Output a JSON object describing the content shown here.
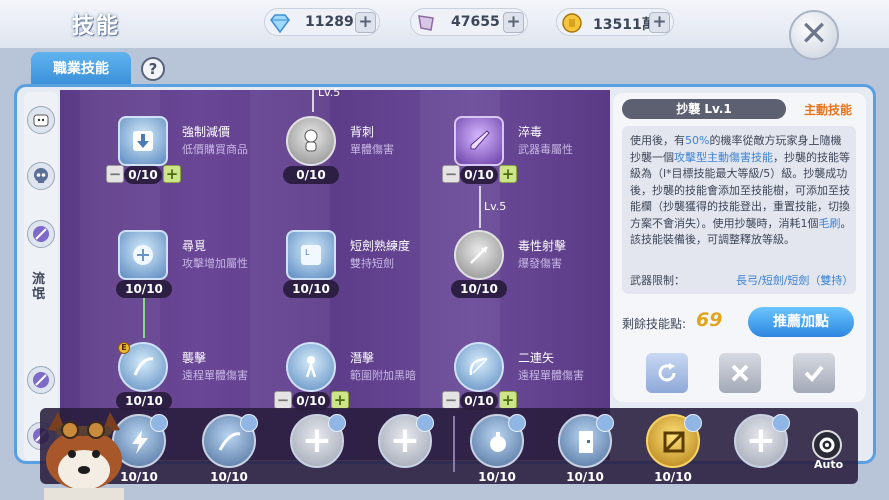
{
  "header": {
    "title": "技能",
    "currencies": [
      {
        "name": "diamond",
        "icon": "diamond-icon",
        "value": "11289"
      },
      {
        "name": "crystal",
        "icon": "crystal-icon",
        "value": "47655"
      },
      {
        "name": "zeny",
        "icon": "coin-icon",
        "value": "13511萬"
      }
    ],
    "close_icon": "close-icon"
  },
  "tabs": {
    "job_skill": "職業技能",
    "help": "?"
  },
  "sidebar": {
    "label": "流氓",
    "icons": [
      "poring-icon",
      "skull-icon",
      "dagger-icon",
      "bow-icon",
      "dagger-icon-2"
    ]
  },
  "skill_tree": {
    "skills": [
      {
        "id": "force_sale",
        "name": "強制減價",
        "desc": "低價購買商品",
        "level": "0/10",
        "buttons": true
      },
      {
        "id": "backstab",
        "name": "背刺",
        "desc": "單體傷害",
        "level": "0/10",
        "buttons": false
      },
      {
        "id": "envenom",
        "name": "淬毒",
        "desc": "武器毒屬性",
        "level": "0/10",
        "buttons": true
      },
      {
        "id": "plagiarism",
        "name": "尋覓",
        "desc": "攻擊增加屬性",
        "level": "10/10",
        "buttons": false
      },
      {
        "id": "dagger_mastery",
        "name": "短劍熟練度",
        "desc": "雙持短劍",
        "level": "10/10",
        "buttons": false
      },
      {
        "id": "poison_shot",
        "name": "毒性射擊",
        "desc": "爆發傷害",
        "level": "10/10",
        "buttons": false
      },
      {
        "id": "snatch",
        "name": "襲擊",
        "desc": "遠程單體傷害",
        "level": "10/10",
        "buttons": false
      },
      {
        "id": "sneak",
        "name": "潛擊",
        "desc": "範圍附加黑暗",
        "level": "0/10",
        "buttons": true
      },
      {
        "id": "double_arrow",
        "name": "二連矢",
        "desc": "遠程單體傷害",
        "level": "0/10",
        "buttons": true
      }
    ],
    "requirements": [
      "Lv.5",
      "Lv.5"
    ]
  },
  "detail": {
    "title": "抄襲 Lv.1",
    "type": "主動技能",
    "description_parts": [
      {
        "text": "使用後，有",
        "hl": false
      },
      {
        "text": "50%",
        "hl": true
      },
      {
        "text": "的機率從敵方玩家身上隨機抄襲一個",
        "hl": false
      },
      {
        "text": "攻擊型主動傷害技能",
        "hl": true
      },
      {
        "text": "，抄襲的技能等級為（l*目標技能最大等級/5）級。抄襲成功後，抄襲的技能會添加至技能樹，可添加至技能欄（抄襲獲得的技能登出，重置技能，切換方案不會消失）。使用抄襲時，消耗1個",
        "hl": false
      },
      {
        "text": "毛刷",
        "hl": true
      },
      {
        "text": "。該技能裝備後，可調整釋放等級。",
        "hl": false
      }
    ],
    "weapon_label": "武器限制：",
    "weapon_value": "長弓/短劍/短劍（雙持）",
    "points_label": "剩餘技能點:",
    "points_value": "69",
    "recommend_button": "推薦加點",
    "actions": [
      "reset-icon",
      "cancel-icon",
      "confirm-icon"
    ]
  },
  "hotbar": {
    "slots": [
      {
        "kind": "skill",
        "level": "10/10"
      },
      {
        "kind": "skill",
        "level": "10/10"
      },
      {
        "kind": "empty",
        "level": ""
      },
      {
        "kind": "empty",
        "level": ""
      },
      {
        "kind": "skill",
        "level": "10/10"
      },
      {
        "kind": "skill",
        "level": "10/10"
      },
      {
        "kind": "gold",
        "level": "10/10"
      },
      {
        "kind": "empty",
        "level": ""
      }
    ],
    "plus_symbol": "+",
    "auto_label": "Auto"
  },
  "colors": {
    "accent": "#3a8ed8",
    "tree_bg": "#5d3d8a",
    "skill_type": "#e8741a",
    "points": "#e0a51c"
  }
}
